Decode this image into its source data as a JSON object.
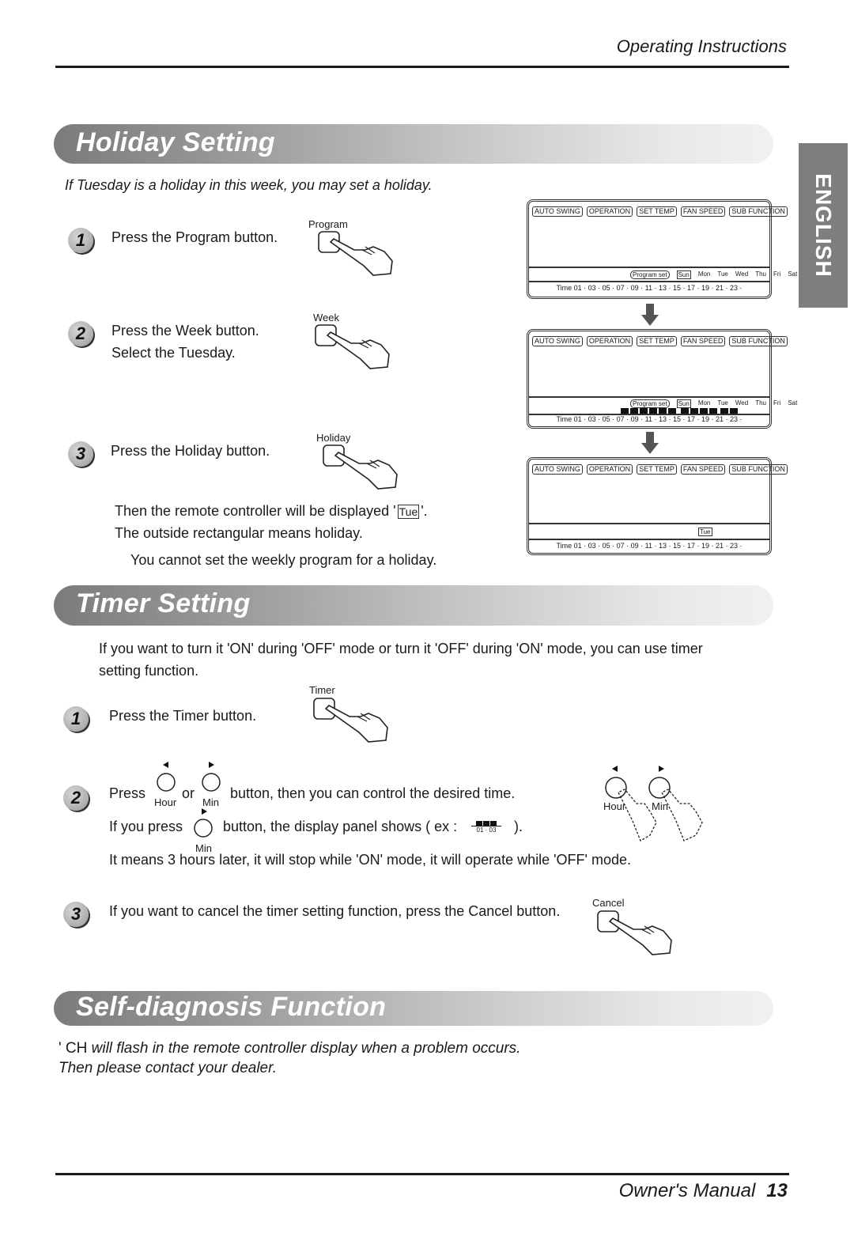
{
  "header": {
    "title": "Operating Instructions"
  },
  "side_tab": {
    "label": "ENGLISH"
  },
  "holiday": {
    "title": "Holiday Setting",
    "intro": "If Tuesday is a holiday in this week, you may set a holiday.",
    "steps": [
      {
        "num": "1",
        "lines": [
          "Press the Program button."
        ],
        "button_label": "Program"
      },
      {
        "num": "2",
        "lines": [
          "Press the Week button.",
          "Select the Tuesday."
        ],
        "button_label": "Week"
      },
      {
        "num": "3",
        "lines": [
          "Press the Holiday button."
        ],
        "button_label": "Holiday"
      }
    ],
    "note_line1_pre": "Then the remote controller will be displayed '",
    "note_symbol": "Tue",
    "note_line1_post": "'.",
    "note_line2": "The outside rectangular means holiday.",
    "note_line3": "You cannot set the weekly program for a holiday."
  },
  "lcd": {
    "chips": [
      "AUTO SWING",
      "OPERATION",
      "SET TEMP",
      "FAN SPEED",
      "SUB FUNCTION"
    ],
    "program_set": "Program set",
    "days": [
      "Sun",
      "Mon",
      "Tue",
      "Wed",
      "Thu",
      "Fri",
      "Sat"
    ],
    "time_row": "Time 01 · 03 · 05 · 07 · 09 · 11 · 13 · 15 · 17 · 19 · 21 · 23 ·",
    "holiday_day": "Tue"
  },
  "timer": {
    "title": "Timer Setting",
    "intro_line1": "If you want to turn it 'ON' during 'OFF' mode or turn it 'OFF' during 'ON' mode, you can use timer",
    "intro_line2": "setting function.",
    "step1": {
      "num": "1",
      "text": "Press the Timer button.",
      "button_label": "Timer"
    },
    "step2": {
      "num": "2",
      "press": "Press",
      "or": "or",
      "hour_label": "Hour",
      "min_label": "Min",
      "line1_rest": "button, then you can control the desired time.",
      "line2_pre": "If you press",
      "line2_rest": "button, the display panel shows ( ex :",
      "line2_end": ").",
      "example_range": "01 · 03",
      "line3": "It means 3 hours later, it will stop while 'ON' mode, it will operate while 'OFF' mode."
    },
    "step3": {
      "num": "3",
      "text": "If you want to cancel the timer setting function, press the Cancel button.",
      "button_label": "Cancel"
    },
    "illus": {
      "hour_label": "Hour",
      "min_label": "Min"
    }
  },
  "diagnosis": {
    "title": "Self-diagnosis Function",
    "line1_prefix": "' CH",
    "line1_rest": " will flash in the remote controller display when a problem occurs.",
    "line2": "Then please contact your dealer."
  },
  "footer": {
    "title": "Owner's Manual",
    "page": "13"
  }
}
